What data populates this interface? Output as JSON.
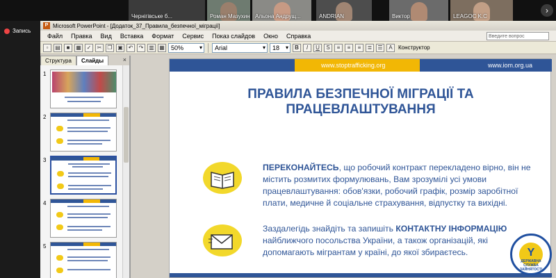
{
  "meeting": {
    "participants": [
      {
        "name": "Чернігівське б..."
      },
      {
        "name": "Роман Мазухин"
      },
      {
        "name": "Альона Андрущ..."
      },
      {
        "name": "ANDRIAN"
      },
      {
        "name": "Виктор"
      },
      {
        "name": "LEAGOC K.C"
      }
    ],
    "more_icon": "chevron-right",
    "record_label": "Запись"
  },
  "ppt": {
    "window_title": "Microsoft PowerPoint - [Додаток_37_Правила_безпечної_міграції]",
    "menu": [
      "Файл",
      "Правка",
      "Вид",
      "Вставка",
      "Формат",
      "Сервис",
      "Показ слайдов",
      "Окно",
      "Справка"
    ],
    "help_placeholder": "Введите вопрос",
    "zoom": "50%",
    "font": "Arial",
    "font_size": "18",
    "design_button": "Конструктор",
    "tabs": {
      "outline": "Структура",
      "slides": "Слайды"
    },
    "slide_numbers": [
      "1",
      "2",
      "3",
      "4",
      "5"
    ],
    "selected_slide": 3
  },
  "slide": {
    "site1": "www.stoptrafficking.org",
    "site2": "www.iom.org.ua",
    "title_line1": "ПРАВИЛА БЕЗПЕЧНОЇ МІГРАЦІЇ ТА",
    "title_line2": "ПРАЦЕВЛАШТУВАННЯ",
    "p1_bold": "ПЕРЕКОНАЙТЕСЬ",
    "p1_rest": ", що робочий контракт перекладено вірно, він не містить розмитих формулювань, Вам зрозумілі усі умови працевлаштування: обов'язки, робочий графік, розмір заробітної плати, медичне й соціальне страхування, відпустку та вихідні.",
    "p2_start": "Заздалегідь знайдіть та запишіть ",
    "p2_bold": "КОНТАКТНУ ІНФОРМАЦІЮ",
    "p2_rest": " найближчого посольства України, а також організацій, які допомагають мігрантам у країні, до якої збираєтесь.",
    "logo_letter": "Y",
    "logo_text": "ДЕРЖАВНА СЛУЖБА ЗАЙНЯТОСТІ"
  },
  "colors": {
    "accent_blue": "#2f5597",
    "accent_yellow": "#f2b705"
  }
}
